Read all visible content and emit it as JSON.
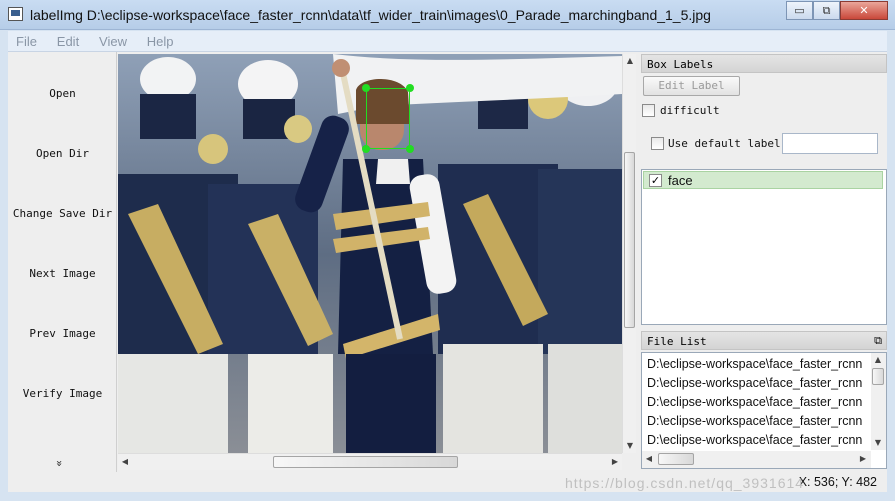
{
  "window": {
    "title": "labelImg D:\\eclipse-workspace\\face_faster_rcnn\\data\\tf_wider_train\\images\\0_Parade_marchingband_1_5.jpg",
    "minimize_glyph": "▭",
    "restore_glyph": "⧉",
    "close_glyph": "✕"
  },
  "menu": [
    "File",
    "Edit",
    "View",
    "Help"
  ],
  "toolbar": {
    "items": [
      "Open",
      "Open Dir",
      "Change Save Dir",
      "Next Image",
      "Prev Image",
      "Verify Image"
    ],
    "more_glyph": "»"
  },
  "box_labels": {
    "title": "Box Labels",
    "edit_label_button": "Edit Label",
    "difficult_label": "difficult",
    "difficult_checked": false,
    "use_default_label": "Use default label",
    "use_default_checked": false,
    "default_label_value": "",
    "labels": [
      {
        "name": "face",
        "checked": true
      }
    ],
    "selected_color": "#d3eacf"
  },
  "file_list": {
    "title": "File List",
    "float_glyph": "⧉",
    "items": [
      "D:\\eclipse-workspace\\face_faster_rcnn",
      "D:\\eclipse-workspace\\face_faster_rcnn",
      "D:\\eclipse-workspace\\face_faster_rcnn",
      "D:\\eclipse-workspace\\face_faster_rcnn",
      "D:\\eclipse-workspace\\face_faster_rcnn"
    ]
  },
  "canvas": {
    "image_name": "0_Parade_marchingband_1_5.jpg",
    "box_label": "face",
    "box_color": "#22dd22"
  },
  "status": {
    "coords": "X: 536; Y: 482"
  },
  "watermark": "https://blog.csdn.net/qq_3931614"
}
